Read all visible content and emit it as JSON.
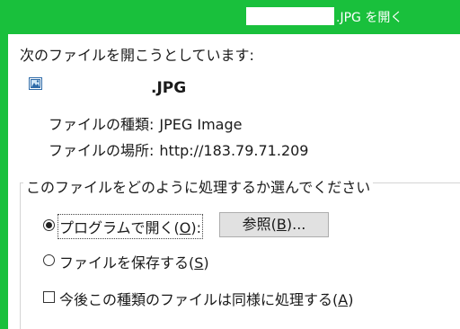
{
  "window": {
    "title_suffix": ".JPG を開く"
  },
  "dialog": {
    "intro": "次のファイルを開こうとしています:",
    "file_icon": "image-file-icon",
    "filename_suffix": ".JPG",
    "type_label": "ファイルの種類:",
    "type_value": "JPEG Image",
    "location_label": "ファイルの場所:",
    "location_value": "http://183.79.71.209",
    "group_title": "このファイルをどのように処理するか選んでください",
    "open_with": {
      "text": "プログラムで開く(",
      "key": "O",
      "end": "):",
      "selected": true
    },
    "browse": {
      "text": "参照(",
      "key": "B",
      "end": ")..."
    },
    "save": {
      "text": "ファイルを保存する(",
      "key": "S",
      "end": ")",
      "selected": false
    },
    "remember": {
      "text": "今後この種類のファイルは同様に処理する(",
      "key": "A",
      "end": ")",
      "checked": false
    }
  },
  "colors": {
    "frame": "#19c03c"
  }
}
